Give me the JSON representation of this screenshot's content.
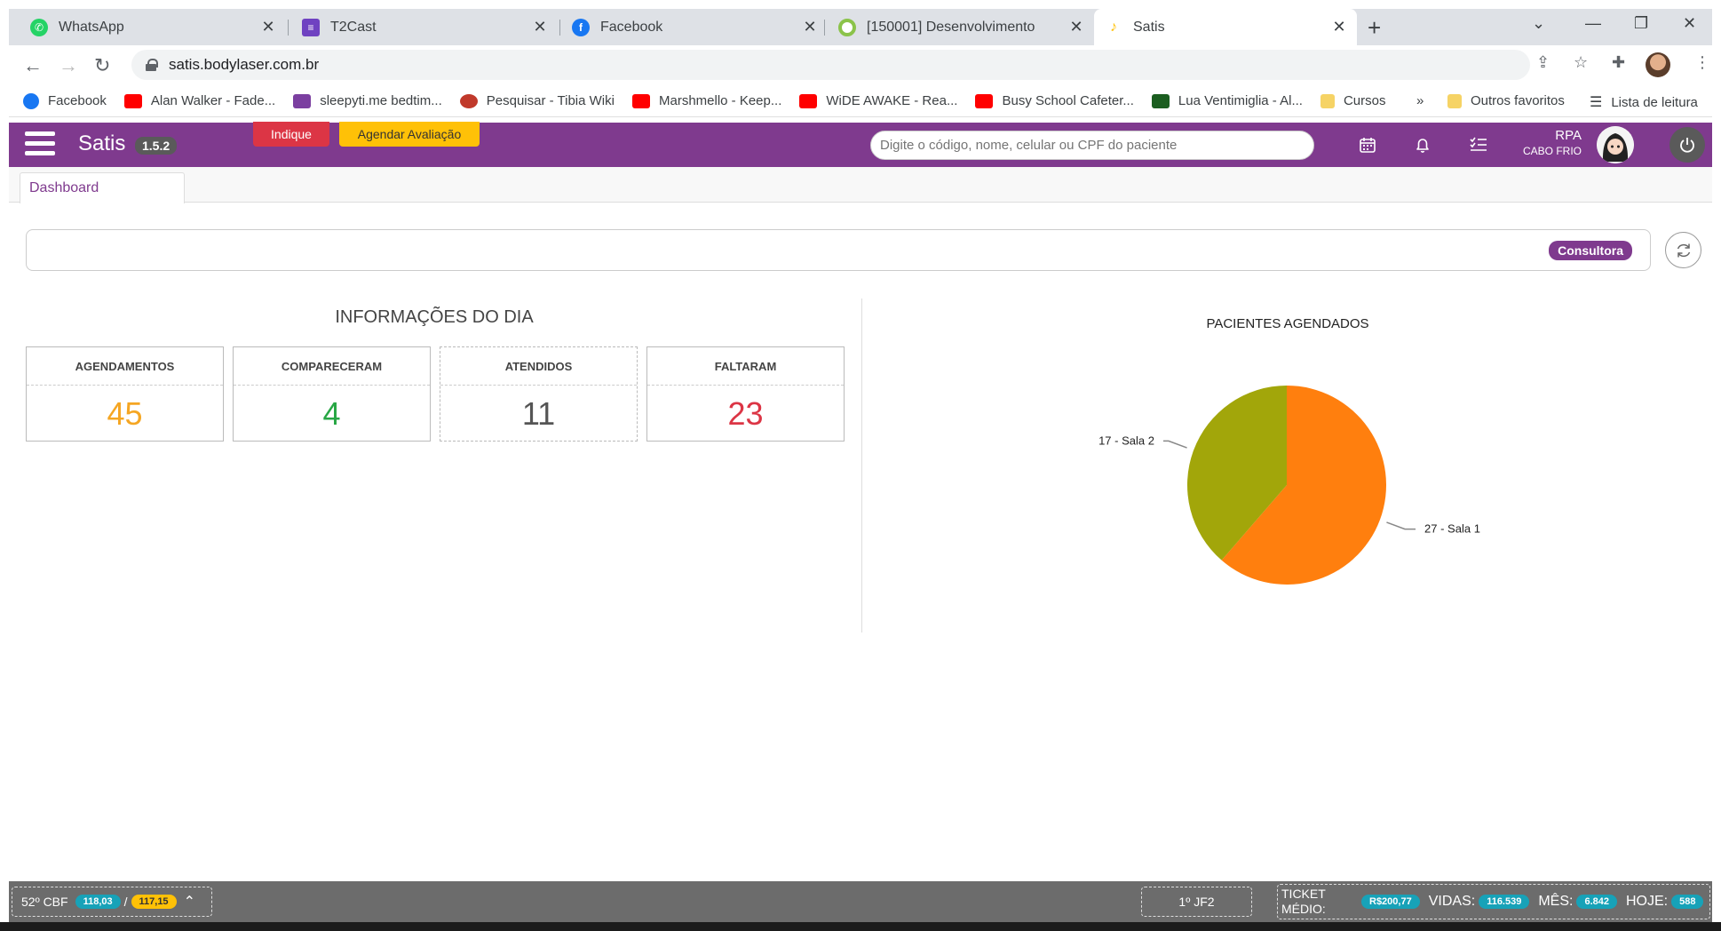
{
  "browser": {
    "tabs": [
      {
        "title": "WhatsApp",
        "icon": "whatsapp-icon",
        "color": "#25d366"
      },
      {
        "title": "T2Cast",
        "icon": "t2cast-icon",
        "color": "#6f42c1"
      },
      {
        "title": "Facebook",
        "icon": "facebook-icon",
        "color": "#1877f2"
      },
      {
        "title": "[150001] Desenvolvimento",
        "icon": "ring-icon",
        "color": "#8bc34a"
      },
      {
        "title": "Satis",
        "icon": "satis-icon",
        "color": "#ffc107"
      }
    ],
    "url": "satis.bodylaser.com.br",
    "bookmarks": [
      {
        "label": "Facebook",
        "color": "#1877f2"
      },
      {
        "label": "Alan Walker - Fade...",
        "color": "#ff0000"
      },
      {
        "label": "sleepyti.me bedtim...",
        "color": "#7b3fa0"
      },
      {
        "label": "Pesquisar - Tibia Wiki",
        "color": "#c0392b"
      },
      {
        "label": "Marshmello - Keep...",
        "color": "#ff0000"
      },
      {
        "label": "WiDE AWAKE - Rea...",
        "color": "#ff0000"
      },
      {
        "label": "Busy School Cafeter...",
        "color": "#ff0000"
      },
      {
        "label": "Lua Ventimiglia - Al...",
        "color": "#1b5e20"
      },
      {
        "label": "Cursos",
        "color": "#f6d365"
      }
    ],
    "bookmarks_overflow": "»",
    "other_favorites": "Outros favoritos",
    "reading_list": "Lista de leitura"
  },
  "app": {
    "brand": "Satis",
    "version": "1.5.2",
    "indique_label": "Indique",
    "agendar_label": "Agendar Avaliação",
    "search_placeholder": "Digite o código, nome, celular ou CPF do paciente",
    "user_name": "RPA",
    "user_unit": "CABO FRIO",
    "tab_label": "Dashboard",
    "consultora_label": "Consultora",
    "accent_color": "#7f3a8e"
  },
  "info": {
    "title": "INFORMAÇÕES DO DIA",
    "cards": [
      {
        "label": "AGENDAMENTOS",
        "value": "45",
        "color": "#f5a623"
      },
      {
        "label": "COMPARECERAM",
        "value": "4",
        "color": "#28a745"
      },
      {
        "label": "ATENDIDOS",
        "value": "11",
        "color": "#555555"
      },
      {
        "label": "FALTARAM",
        "value": "23",
        "color": "#dc3545"
      }
    ]
  },
  "chart_data": {
    "type": "pie",
    "title": "PACIENTES AGENDADOS",
    "slices": [
      {
        "label": "27 - Sala 1",
        "value": 27,
        "color": "#ff7f0e"
      },
      {
        "label": "17 - Sala 2",
        "value": 17,
        "color": "#a2a60a"
      }
    ]
  },
  "status": {
    "temp_label": "52º CBF",
    "temp_a": "118,03",
    "separator": "/",
    "temp_b": "117,15",
    "jf_label": "1º JF2",
    "ticket_label": "TICKET MÉDIO:",
    "ticket_value": "R$200,77",
    "vidas_label": "VIDAS:",
    "vidas_value": "116.539",
    "mes_label": "MÊS:",
    "mes_value": "6.842",
    "hoje_label": "HOJE:",
    "hoje_value": "588"
  }
}
